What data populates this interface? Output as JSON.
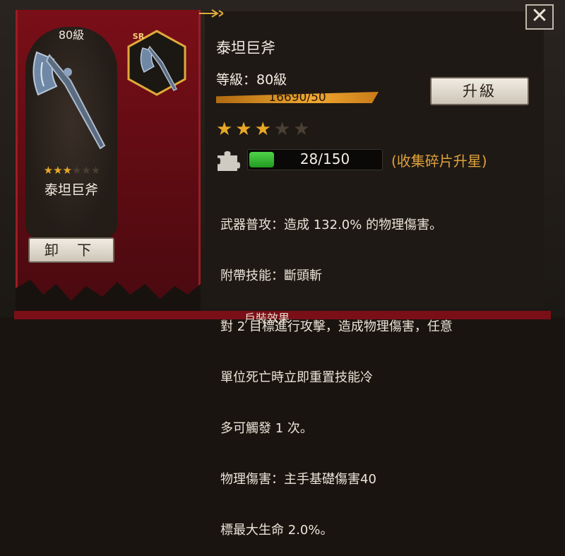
{
  "item_card": {
    "level": "80級",
    "name": "泰坦巨斧",
    "stars_filled": 3,
    "stars_total": 6,
    "unequip_label": "卸 下",
    "rarity": "SR"
  },
  "details": {
    "weapon_name": "泰坦巨斧",
    "level_label": "等級：80級",
    "exp_text": "16690/50",
    "upgrade_label": "升級",
    "stars_filled": 3,
    "stars_total": 5,
    "shard_text": "28/150",
    "shard_progress": 0.1867,
    "collect_hint": "(收集碎片升星)",
    "description_lines": [
      "武器普攻：造成 132.0% 的物理傷害。",
      "附帶技能：斷頭斬",
      "對 2 目標進行攻擊，造成物理傷害，任意",
      "單位死亡時立即重置技能冷",
      "多可觸發 1 次。",
      "物理傷害：主手基礎傷害40",
      "標最大生命 2.0%。"
    ]
  },
  "close_label": "✕",
  "bottom_label": "戶裝效果",
  "colors": {
    "banner_red": "#7a0f18",
    "gold": "#e8a826",
    "green": "#3cc03a"
  },
  "icons": [
    "axe-weapon-icon",
    "puzzle-piece-icon",
    "close-icon",
    "star-icon",
    "arrow-icon"
  ]
}
